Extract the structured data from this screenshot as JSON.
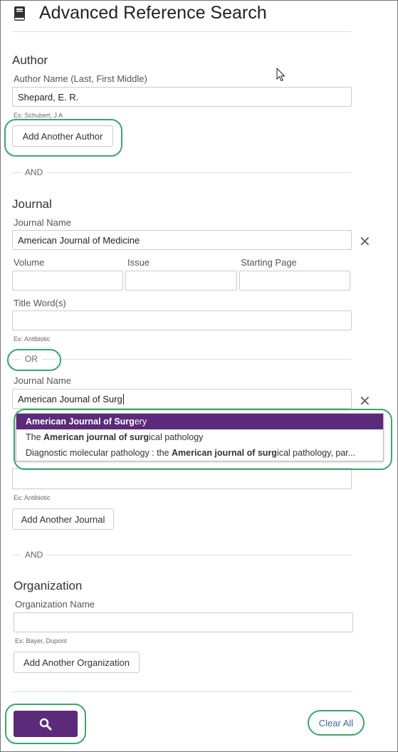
{
  "header": {
    "title": "Advanced Reference Search",
    "icon": "book-icon"
  },
  "author": {
    "heading": "Author",
    "name_label": "Author Name (Last, First Middle)",
    "name_value": "Shepard, E. R.",
    "hint": "Ex: Schubert, J A",
    "add_button": "Add Another Author"
  },
  "sep1": "AND",
  "journal": {
    "heading": "Journal",
    "name_label": "Journal Name",
    "name_value": "American Journal of Medicine",
    "volume_label": "Volume",
    "issue_label": "Issue",
    "page_label": "Starting Page",
    "title_label": "Title Word(s)",
    "hint": "Ex: Antibiotic",
    "or_label": "OR",
    "name2_label": "Journal Name",
    "name2_value": "American Journal of Surg",
    "hint2": "Ex: Antibiotic",
    "add_button": "Add Another Journal",
    "autocomplete": [
      {
        "pre": "",
        "bold": "American Journal of Surg",
        "post": "ery"
      },
      {
        "pre": "The ",
        "bold": "American journal of surg",
        "post": "ical pathology"
      },
      {
        "pre": "Diagnostic molecular pathology : the ",
        "bold": "American journal of surg",
        "post": "ical pathology, par..."
      }
    ]
  },
  "sep2": "AND",
  "organization": {
    "heading": "Organization",
    "name_label": "Organization Name",
    "name_value": "",
    "hint": "Ex: Bayer, Dupont",
    "add_button": "Add Another Organization"
  },
  "footer": {
    "clear_label": "Clear All",
    "search_icon": "search-icon"
  },
  "colors": {
    "accent": "#5b2a7a",
    "highlight_outline": "#3aa76a",
    "link": "#3a6aa8"
  }
}
